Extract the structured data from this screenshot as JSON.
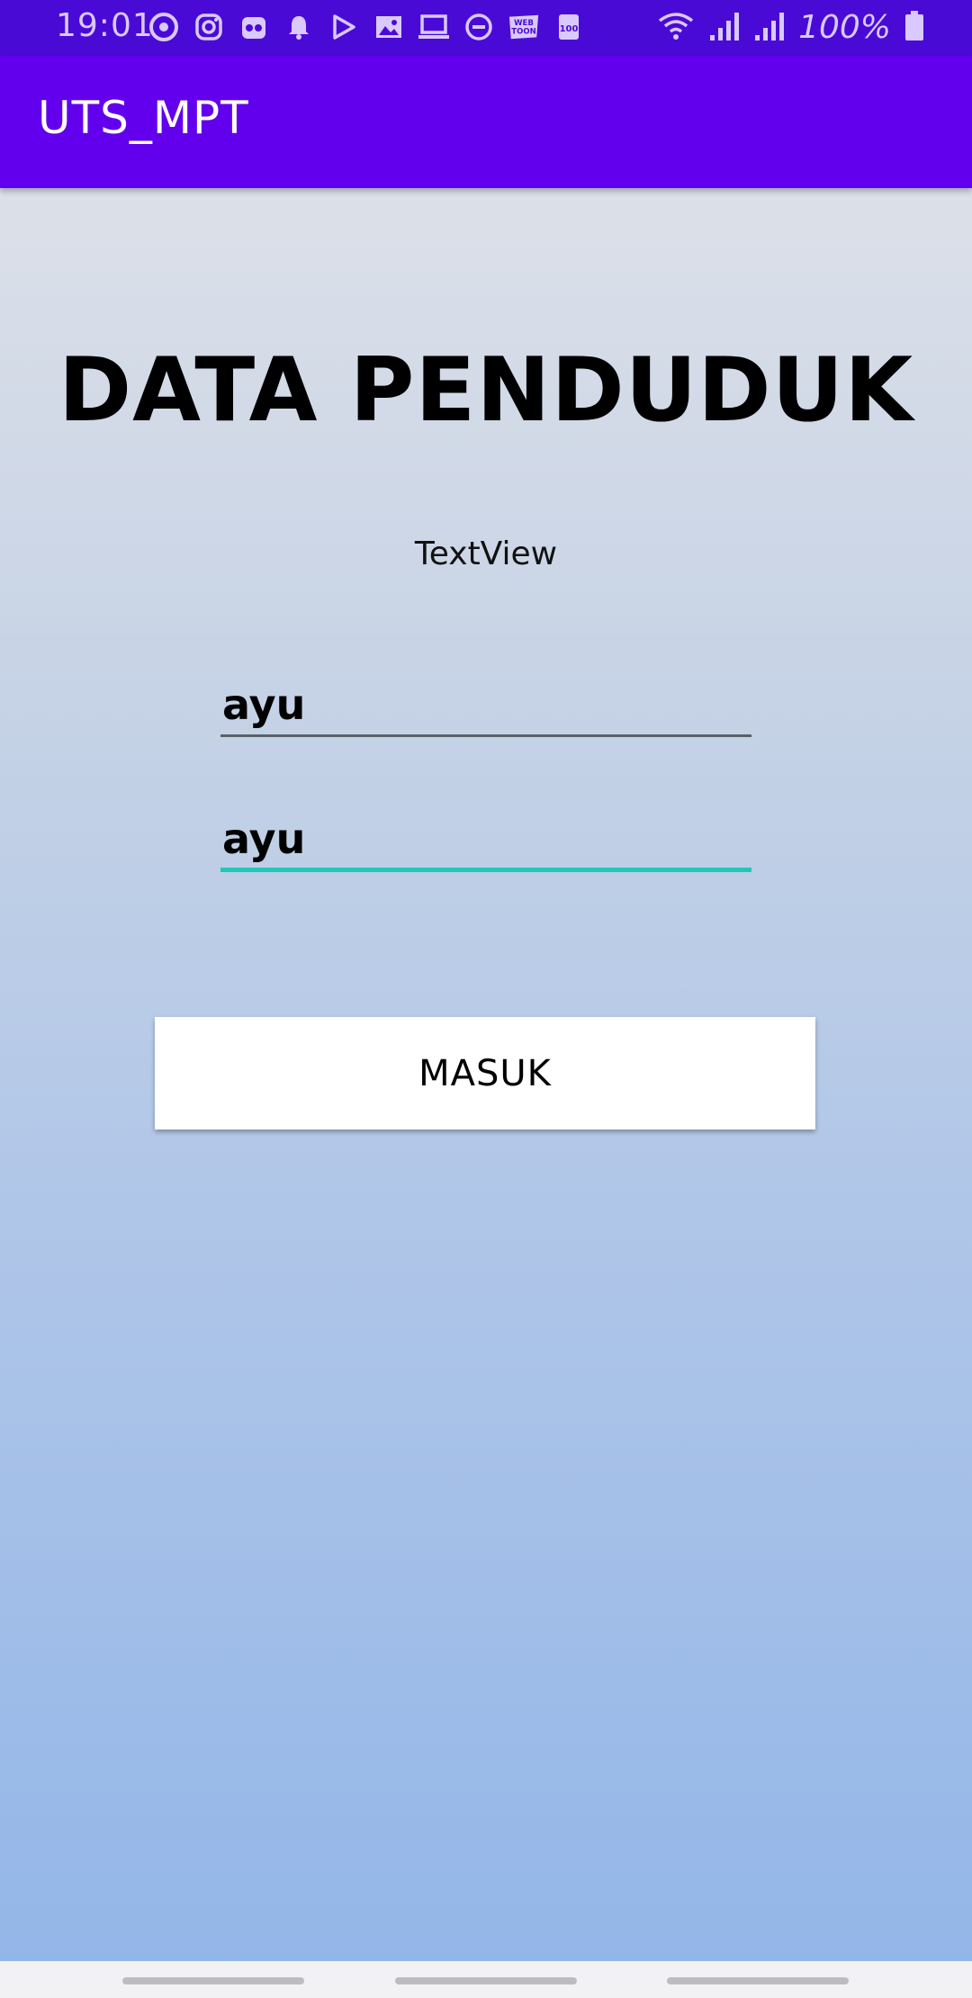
{
  "status_bar": {
    "time": "19:01",
    "battery": "100%",
    "notification_icons": [
      "at-sign-icon",
      "instagram-icon",
      "owl-app-icon",
      "bell-icon",
      "play-store-icon",
      "image-icon",
      "laptop-icon",
      "do-not-disturb-icon",
      "webtoon-icon",
      "app-100-icon"
    ],
    "webtoon_label": "WEB TOON",
    "app_100_label": "100"
  },
  "app_bar": {
    "title": "UTS_MPT",
    "color": "#6200ee"
  },
  "main": {
    "title": "DATA PENDUDUK",
    "text_view": "TextView",
    "field_1_value": "ayu",
    "field_2_value": "ayu",
    "button_label": "MASUK",
    "accent_color": "#1ec9b7"
  }
}
